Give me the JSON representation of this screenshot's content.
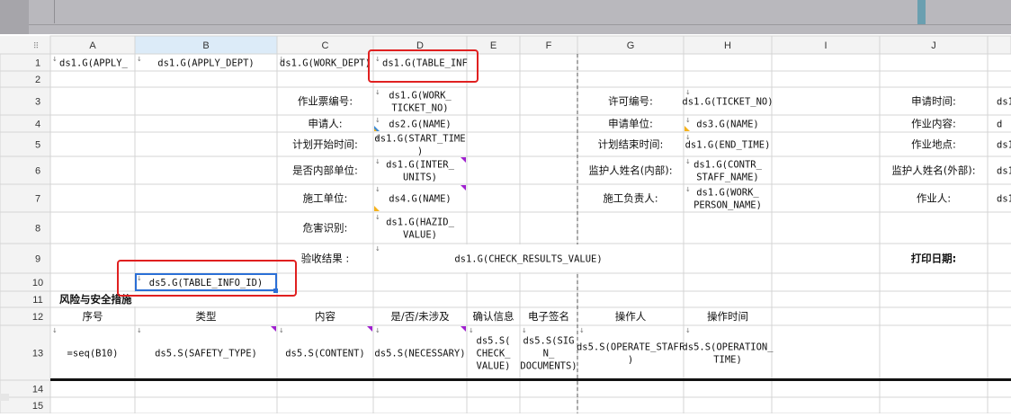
{
  "columns": [
    "A",
    "B",
    "C",
    "D",
    "E",
    "F",
    "G",
    "H",
    "I",
    "J",
    ""
  ],
  "selected_column": "B",
  "rows": [
    {
      "num": "1",
      "cells": [
        {
          "col": 0,
          "text": "ds1.G(APPLY_",
          "align": "left"
        },
        {
          "col": 1,
          "text": "ds1.G(APPLY_DEPT)"
        },
        {
          "col": 2,
          "text": "ds1.G(WORK_DEPT)"
        },
        {
          "col": 3,
          "text": "ds1.G(TABLE_INF",
          "align": "left"
        }
      ]
    },
    {
      "num": "2",
      "cells": []
    },
    {
      "num": "3",
      "cells": [
        {
          "col": 2,
          "text": "作业票编号:",
          "font": "sans"
        },
        {
          "col": 3,
          "text": "ds1.G(WORK_\nTICKET_NO)"
        },
        {
          "col": 6,
          "text": "许可编号:",
          "font": "sans"
        },
        {
          "col": 7,
          "text": "ds1.G(TICKET_NO)"
        },
        {
          "col": 9,
          "text": "申请时间:",
          "font": "sans"
        },
        {
          "col": 10,
          "text": "ds1",
          "align": "left"
        }
      ]
    },
    {
      "num": "4",
      "cells": [
        {
          "col": 2,
          "text": "申请人:",
          "font": "sans"
        },
        {
          "col": 3,
          "text": "ds2.G(NAME)"
        },
        {
          "col": 6,
          "text": "申请单位:",
          "font": "sans"
        },
        {
          "col": 7,
          "text": "ds3.G(NAME)"
        },
        {
          "col": 9,
          "text": "作业内容:",
          "font": "sans"
        },
        {
          "col": 10,
          "text": "d",
          "align": "left"
        }
      ]
    },
    {
      "num": "5",
      "cells": [
        {
          "col": 2,
          "text": "计划开始时间:",
          "font": "sans"
        },
        {
          "col": 3,
          "text": "ds1.G(START_TIME\n)"
        },
        {
          "col": 6,
          "text": "计划结束时间:",
          "font": "sans"
        },
        {
          "col": 7,
          "text": "ds1.G(END_TIME)"
        },
        {
          "col": 9,
          "text": "作业地点:",
          "font": "sans"
        },
        {
          "col": 10,
          "text": "ds1",
          "align": "left"
        }
      ]
    },
    {
      "num": "6",
      "cells": [
        {
          "col": 2,
          "text": "是否内部单位:",
          "font": "sans"
        },
        {
          "col": 3,
          "text": "ds1.G(INTER_\nUNITS)"
        },
        {
          "col": 6,
          "text": "监护人姓名(内部):",
          "font": "sans"
        },
        {
          "col": 7,
          "text": "ds1.G(CONTR_\nSTAFF_NAME)"
        },
        {
          "col": 9,
          "text": "监护人姓名(外部):",
          "font": "sans"
        },
        {
          "col": 10,
          "text": "ds1.",
          "align": "left"
        }
      ]
    },
    {
      "num": "7",
      "cells": [
        {
          "col": 2,
          "text": "施工单位:",
          "font": "sans"
        },
        {
          "col": 3,
          "text": "ds4.G(NAME)"
        },
        {
          "col": 6,
          "text": "施工负责人:",
          "font": "sans"
        },
        {
          "col": 7,
          "text": "ds1.G(WORK_\nPERSON_NAME)"
        },
        {
          "col": 9,
          "text": "作业人:",
          "font": "sans"
        },
        {
          "col": 10,
          "text": "ds1.",
          "align": "left"
        }
      ]
    },
    {
      "num": "8",
      "cells": [
        {
          "col": 2,
          "text": "危害识别:",
          "font": "sans"
        },
        {
          "col": 3,
          "text": "ds1.G(HAZID_\nVALUE)"
        }
      ]
    },
    {
      "num": "9",
      "cells": [
        {
          "col": 2,
          "text": "验收结果 :",
          "font": "sans"
        },
        {
          "col": 3,
          "span": 4,
          "text": "ds1.G(CHECK_RESULTS_VALUE)"
        },
        {
          "col": 9,
          "text": "打印日期:",
          "font": "sans",
          "bold": true
        }
      ]
    },
    {
      "num": "10",
      "cells": [
        {
          "col": 1,
          "text": "ds5.G(TABLE_INFO_ID)"
        }
      ]
    },
    {
      "num": "11",
      "cells": [
        {
          "col": 0,
          "span": 2,
          "text": "风险与安全措施",
          "font": "sans",
          "bold": true,
          "align": "left"
        }
      ]
    },
    {
      "num": "12",
      "cells": [
        {
          "col": 0,
          "text": "序号",
          "font": "sans"
        },
        {
          "col": 1,
          "text": "类型",
          "font": "sans"
        },
        {
          "col": 2,
          "text": "内容",
          "font": "sans"
        },
        {
          "col": 3,
          "text": "是/否/未涉及",
          "font": "sans"
        },
        {
          "col": 4,
          "text": "确认信息",
          "font": "sans"
        },
        {
          "col": 5,
          "text": "电子签名",
          "font": "sans"
        },
        {
          "col": 6,
          "text": "操作人",
          "font": "sans"
        },
        {
          "col": 7,
          "text": "操作时间",
          "font": "sans"
        }
      ]
    },
    {
      "num": "13",
      "cells": [
        {
          "col": 0,
          "text": "=seq(B10)"
        },
        {
          "col": 1,
          "text": "ds5.S(SAFETY_TYPE)"
        },
        {
          "col": 2,
          "text": "ds5.S(CONTENT)"
        },
        {
          "col": 3,
          "text": "ds5.S(NECESSARY)"
        },
        {
          "col": 4,
          "text": "ds5.S(\nCHECK_\nVALUE)"
        },
        {
          "col": 5,
          "text": "ds5.S(SIG\nN_\nDOCUMENTS)"
        },
        {
          "col": 6,
          "text": "ds5.S(OPERATE_STAFF\n)"
        },
        {
          "col": 7,
          "text": "ds5.S(OPERATION_\nTIME)"
        }
      ]
    },
    {
      "num": "14",
      "cells": []
    },
    {
      "num": "15",
      "cells": []
    }
  ],
  "colors": {
    "gridline": "#d4d4d4",
    "header_bg": "#f3f3f3",
    "header_selected_bg": "#dcebf8",
    "selection": "#2b6fd6",
    "annotation_red": "#e02020",
    "marker_orange": "#f5b21c",
    "marker_purple": "#a020d0",
    "marker_blue": "#3a8ad6"
  }
}
